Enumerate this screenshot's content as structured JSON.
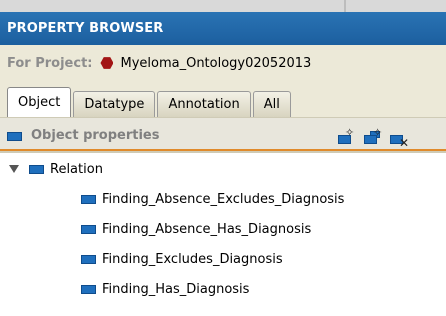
{
  "panel": {
    "title": "PROPERTY BROWSER",
    "project_label": "For Project:",
    "project_name": "Myeloma_Ontology02052013"
  },
  "tabs": [
    {
      "label": "Object",
      "selected": true
    },
    {
      "label": "Datatype",
      "selected": false
    },
    {
      "label": "Annotation",
      "selected": false
    },
    {
      "label": "All",
      "selected": false
    }
  ],
  "section": {
    "title": "Object properties",
    "actions": [
      {
        "icon": "create-property-icon"
      },
      {
        "icon": "create-subproperty-icon"
      },
      {
        "icon": "delete-property-icon"
      }
    ]
  },
  "tree": {
    "root": {
      "label": "Relation",
      "expanded": true
    },
    "children": [
      {
        "label": "Finding_Absence_Excludes_Diagnosis"
      },
      {
        "label": "Finding_Absence_Has_Diagnosis"
      },
      {
        "label": "Finding_Excludes_Diagnosis"
      },
      {
        "label": "Finding_Has_Diagnosis"
      }
    ]
  },
  "colors": {
    "title_bar": "#1c5f9f",
    "accent_orange": "#e08a2a",
    "property_icon": "#1f6fbd",
    "project_icon": "#a31515"
  }
}
